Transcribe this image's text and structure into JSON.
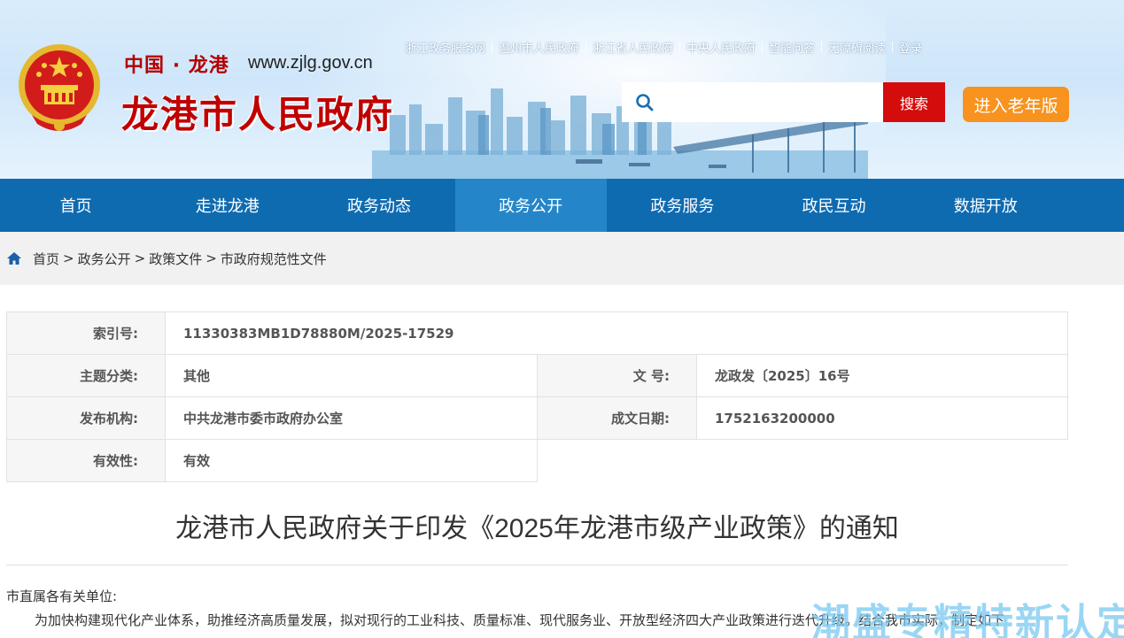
{
  "header": {
    "brand_top": "中国",
    "brand_dot": "·",
    "brand_city": "龙港",
    "brand_url": "www.zjlg.gov.cn",
    "brand_title": "龙港市人民政府",
    "top_links": [
      "浙江政务服务网",
      "温州市人民政府",
      "浙江省人民政府",
      "中央人民政府",
      "智能问答",
      "无障碍阅读",
      "登录"
    ],
    "search": {
      "placeholder": "",
      "value": "",
      "button": "搜索"
    },
    "elder_button": "进入老年版"
  },
  "nav": {
    "items": [
      "首页",
      "走进龙港",
      "政务动态",
      "政务公开",
      "政务服务",
      "政民互动",
      "数据开放"
    ],
    "active": "政务公开"
  },
  "breadcrumb": [
    "首页",
    "政务公开",
    "政策文件",
    "市政府规范性文件"
  ],
  "meta": {
    "index_label": "索引号:",
    "index_value": "11330383MB1D78880M/2025-17529",
    "topic_label": "主题分类:",
    "topic_value": "其他",
    "docno_label": "文 号:",
    "docno_value": "龙政发〔2025〕16号",
    "issuer_label": "发布机构:",
    "issuer_value": "中共龙港市委市政府办公室",
    "date_label": "成文日期:",
    "date_value": "1752163200000",
    "validity_label": "有效性:",
    "validity_value": "有效"
  },
  "article": {
    "title": "龙港市人民政府关于印发《2025年龙港市级产业政策》的通知",
    "salutation": "市直属各有关单位:",
    "paragraph": "为加快构建现代化产业体系，助推经济高质量发展，拟对现行的工业科技、质量标准、现代服务业、开放型经济四大产业政策进行迭代升级。结合我市实际，制定如下"
  },
  "watermark": "潮盛专精特新认定网",
  "colors": {
    "nav": "#0f6bb0",
    "nav_active": "#2486c9",
    "search_button": "#d40c0c",
    "elder_button": "#f7931e",
    "brand_red": "#c00000"
  }
}
